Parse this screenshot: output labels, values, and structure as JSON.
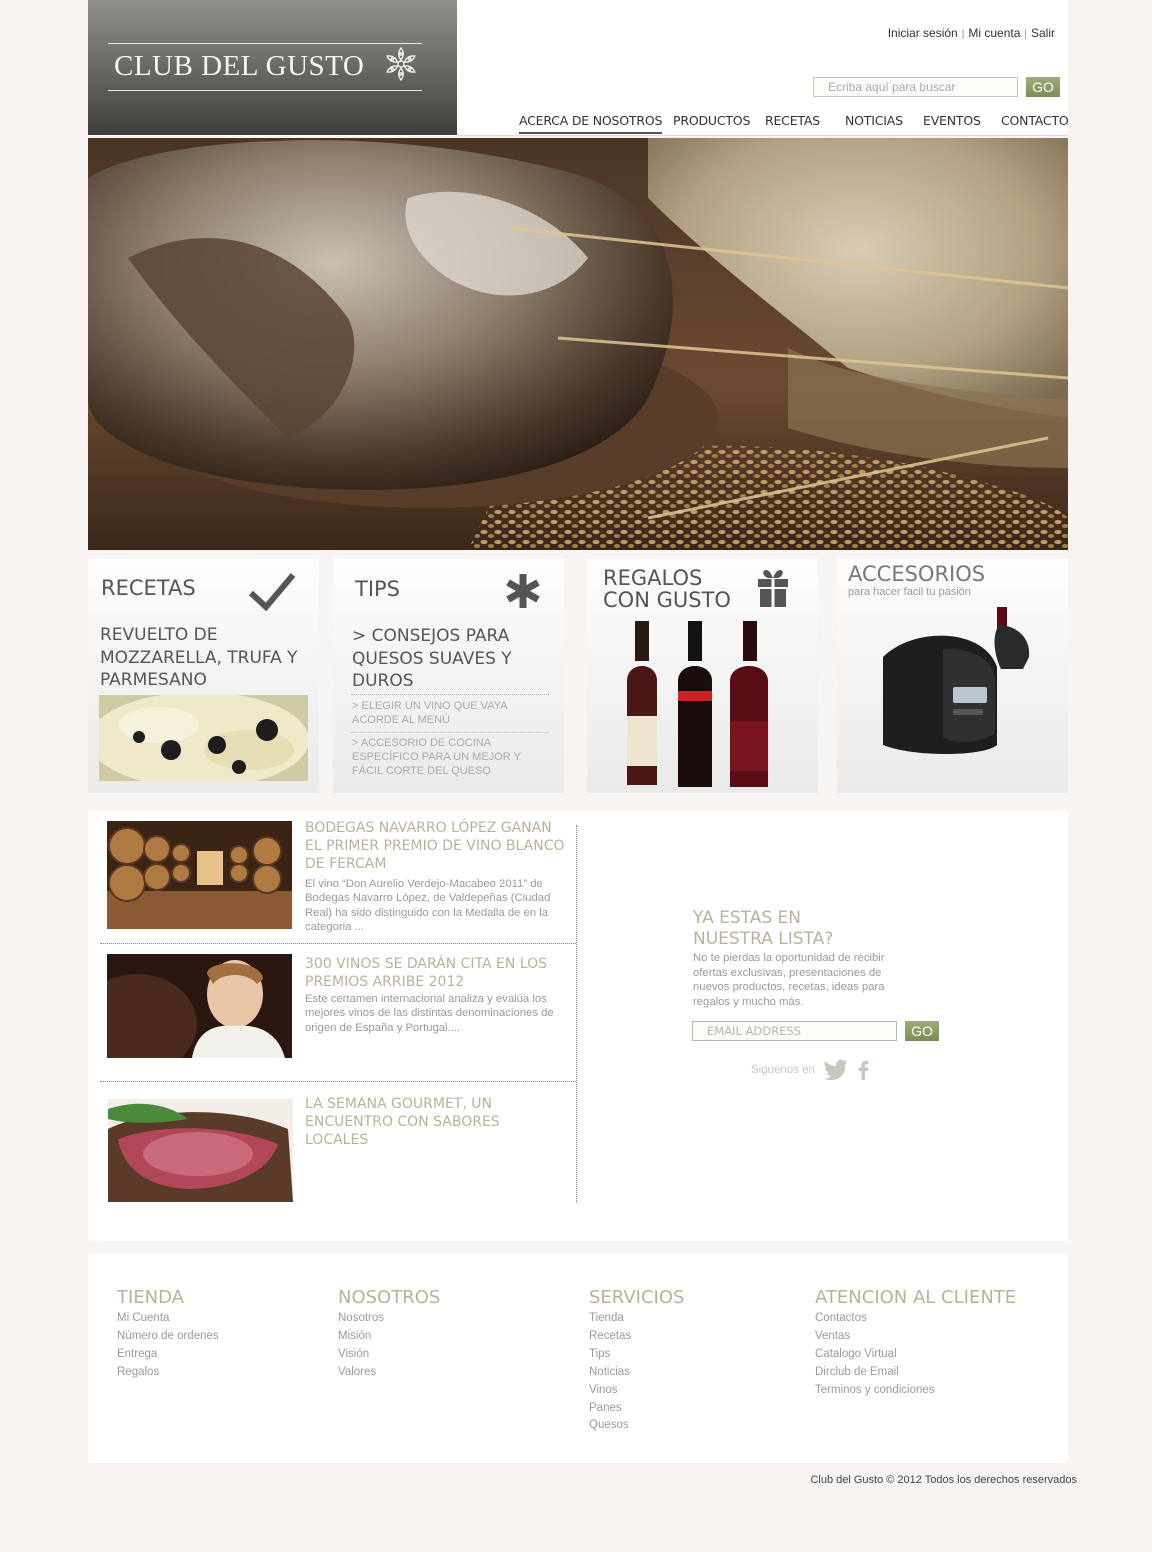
{
  "brand": {
    "logo_text": "CLUB DEL GUSTO"
  },
  "user_links": {
    "login": "Iniciar sesión",
    "account": "Mi cuenta",
    "logout": "Salir"
  },
  "search": {
    "placeholder": "Ecriba aquí para buscar",
    "button": "GO"
  },
  "nav": {
    "items": [
      {
        "label": "ACERCA DE NOSOTROS",
        "active": true
      },
      {
        "label": "PRODUCTOS",
        "active": false
      },
      {
        "label": "RECETAS",
        "active": false
      },
      {
        "label": "NOTICIAS",
        "active": false
      },
      {
        "label": "EVENTOS",
        "active": false
      },
      {
        "label": "CONTACTO",
        "active": false
      }
    ]
  },
  "features": {
    "recetas": {
      "title": "RECETAS",
      "headline": "REVUELTO DE MOZZARELLA, TRUFA Y PARMESANO",
      "icon": "checkmark-icon"
    },
    "tips": {
      "title": "TIPS",
      "icon": "asterisk-icon",
      "headline": "> CONSEJOS PARA QUESOS SUAVES Y DUROS",
      "links": [
        "> ELEGIR UN VINO QUE VAYA ACORDE AL MENÚ",
        "> ACCESORIO DE COCINA ESPECÍFICO PARA UN MEJOR Y FÁCIL CORTE DEL QUESO"
      ]
    },
    "regalos": {
      "title_line1": "REGALOS",
      "title_line2": "CON GUSTO",
      "icon": "gift-icon"
    },
    "accesorios": {
      "title": "ACCESORIOS",
      "subtitle": "para hacer facil tu pasión"
    }
  },
  "news": [
    {
      "title": "BODEGAS NAVARRO LÓPEZ GANAN EL PRIMER PREMIO DE VINO BLANCO DE FERCAM",
      "body": "El vino “Don Aurelio Verdejo-Macabeo 2011” de Bodegas Navarro López, de Valdepeñas (Ciudad Real) ha sido distinguido con la Medalla de  en la categoria ..."
    },
    {
      "title": "300 VINOS SE DARÁN CITA EN LOS PREMIOS ARRIBE 2012",
      "body": "Este certamen internacional analiza y evalúa los mejores vinos de las distintas denominaciones de origen de España y Portugal...."
    },
    {
      "title": "LA SEMANA GOURMET, UN ENCUENTRO CON SABORES LOCALES",
      "body": ""
    }
  ],
  "newsletter": {
    "title": "YA ESTAS EN NUESTRA LISTA?",
    "body": "No te pierdas la oportunidad de recibir ofertas exclusivas, presentaciones de nuevos productos, recetas, ideas para regalos y mucho más.",
    "email_placeholder": "EMAIL ADDRESS",
    "button": "GO",
    "follow": "Siguenos en"
  },
  "footer": {
    "columns": [
      {
        "title": "TIENDA",
        "links": [
          "Mi Cuenta",
          "Número de ordenes",
          "Entrega",
          "Regalos"
        ]
      },
      {
        "title": "NOSOTROS",
        "links": [
          "Nosotros",
          "Misión",
          "Visión",
          "Valores"
        ]
      },
      {
        "title": "SERVICIOS",
        "links": [
          "Tienda",
          "Recetas",
          "Tips",
          "Noticias",
          "Vinos",
          "Panes",
          "Quesos"
        ]
      },
      {
        "title": "ATENCION AL CLIENTE",
        "links": [
          "Contactos",
          "Ventas",
          "Catalogo Virtual",
          "Dirclub de Email",
          "Terminos y condiciones"
        ]
      }
    ],
    "copyright": "Club del Gusto © 2012 Todos los derechos reservados"
  },
  "colors": {
    "accent_green": "#8a9863",
    "title_beige": "#b9b29a",
    "page_bg": "#f7f4f1"
  }
}
